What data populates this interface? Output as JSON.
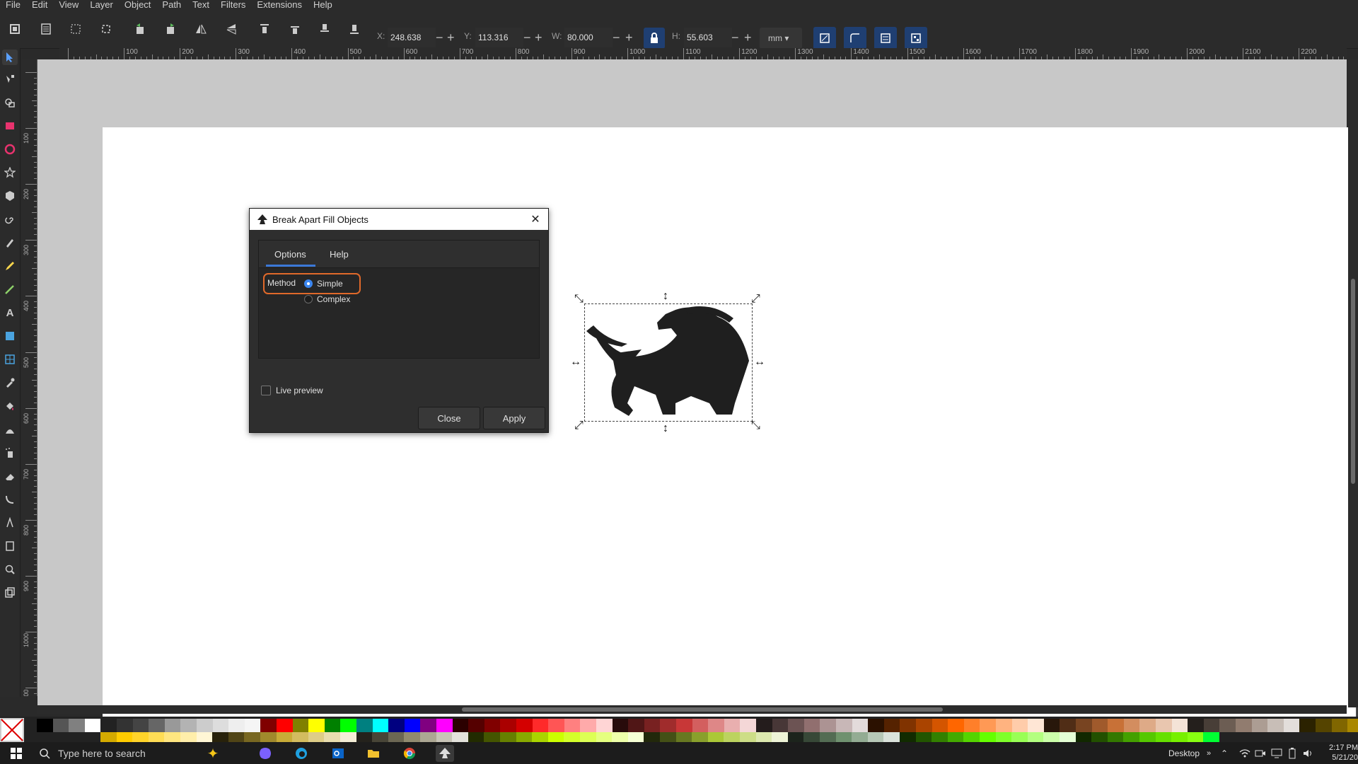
{
  "menu": [
    "File",
    "Edit",
    "View",
    "Layer",
    "Object",
    "Path",
    "Text",
    "Filters",
    "Extensions",
    "Help"
  ],
  "controls": {
    "x_label": "X:",
    "x_value": "248.638",
    "y_label": "Y:",
    "y_value": "113.316",
    "w_label": "W:",
    "w_value": "80.000",
    "h_label": "H:",
    "h_value": "55.603",
    "unit": "mm"
  },
  "ruler": {
    "h_labels": [
      "100",
      "200",
      "300",
      "400",
      "500",
      "600",
      "700",
      "800",
      "900",
      "1000",
      "1100",
      "1200",
      "1300",
      "1400",
      "1500",
      "1600",
      "1700",
      "1800",
      "1900",
      "2000",
      "2100",
      "2200"
    ],
    "v_labels": [
      "100",
      "200",
      "300",
      "400",
      "500",
      "600",
      "700",
      "800",
      "900",
      "1000",
      "1100"
    ]
  },
  "dialog": {
    "title": "Break Apart Fill Objects",
    "tabs": [
      "Options",
      "Help"
    ],
    "active_tab": "Options",
    "method_label": "Method",
    "options": [
      "Simple",
      "Complex"
    ],
    "selected_option": "Simple",
    "live_preview_label": "Live preview",
    "live_preview_checked": false,
    "close_label": "Close",
    "apply_label": "Apply"
  },
  "taskbar": {
    "search_placeholder": "Type here to search",
    "desktop_label": "Desktop",
    "time": "2:17 PM",
    "date": "5/21/20"
  },
  "colors": {
    "accent": "#3b86f0",
    "highlight": "#e0692a",
    "lock_button": "#1f3f72"
  }
}
